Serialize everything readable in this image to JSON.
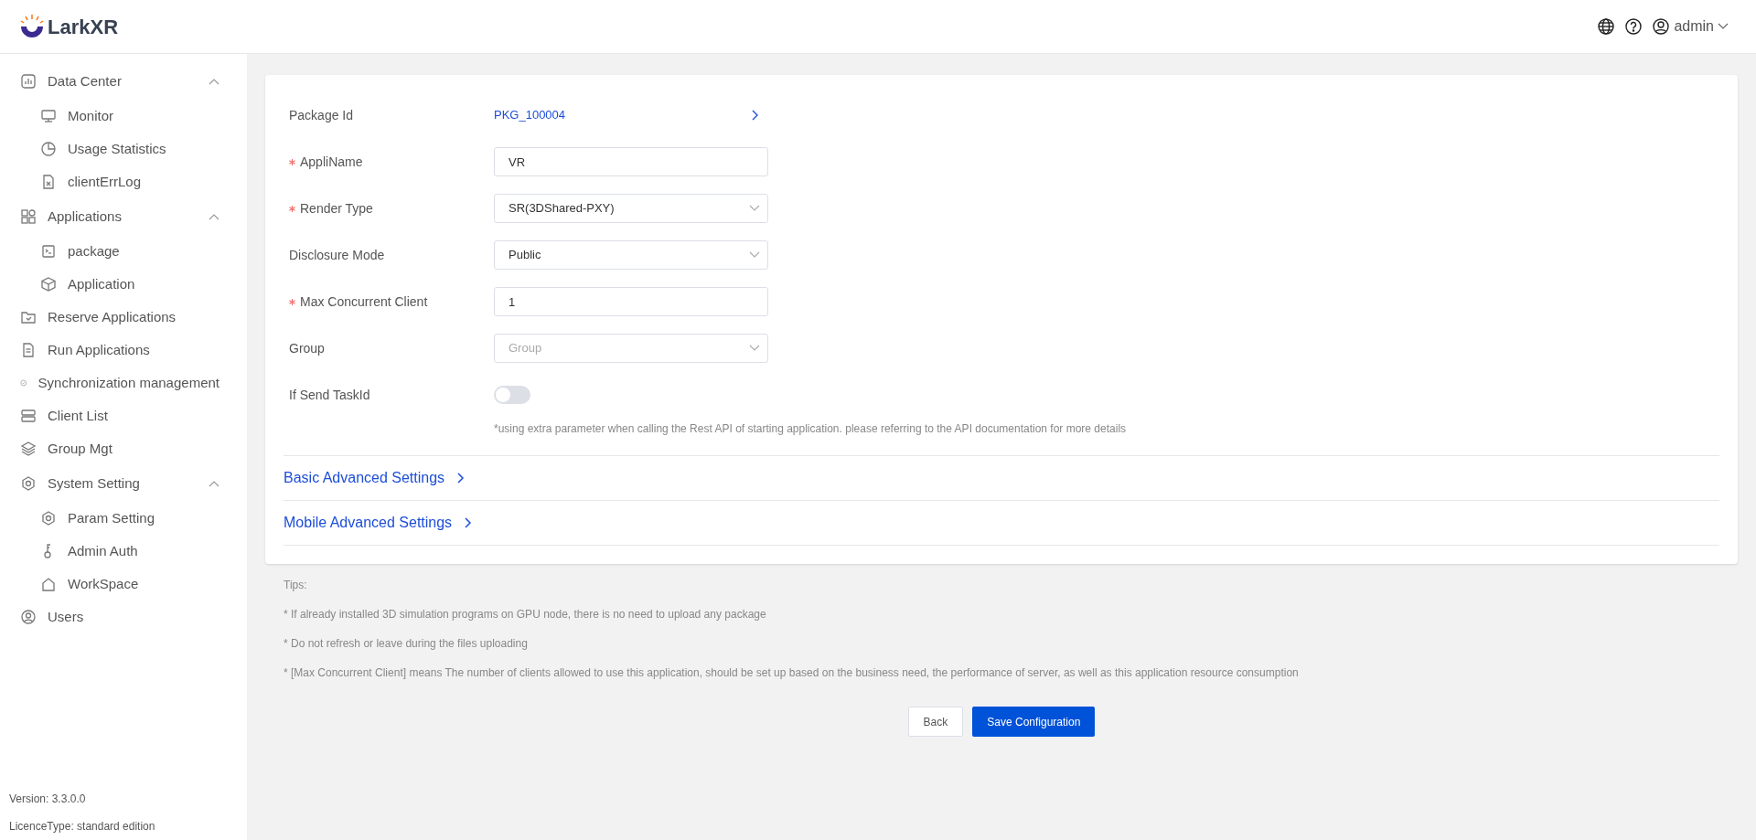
{
  "header": {
    "logo": "LarkXR",
    "user": "admin"
  },
  "sidebar": {
    "items": [
      {
        "label": "Data Center",
        "expanded": true,
        "children": [
          {
            "label": "Monitor"
          },
          {
            "label": "Usage Statistics"
          },
          {
            "label": "clientErrLog"
          }
        ]
      },
      {
        "label": "Applications",
        "expanded": true,
        "children": [
          {
            "label": "package"
          },
          {
            "label": "Application"
          }
        ]
      },
      {
        "label": "Reserve Applications"
      },
      {
        "label": "Run Applications"
      },
      {
        "label": "Synchronization management"
      },
      {
        "label": "Client List"
      },
      {
        "label": "Group Mgt"
      },
      {
        "label": "System Setting",
        "expanded": true,
        "children": [
          {
            "label": "Param Setting"
          },
          {
            "label": "Admin Auth"
          },
          {
            "label": "WorkSpace"
          }
        ]
      },
      {
        "label": "Users"
      }
    ],
    "footer": [
      "Version: 3.3.0.0",
      "LicenceType: standard edition"
    ]
  },
  "form": {
    "fields": [
      {
        "kind": "link",
        "label": "Package Id",
        "required": false,
        "value": "PKG_100004"
      },
      {
        "kind": "input",
        "label": "AppliName",
        "required": true,
        "value": "VR"
      },
      {
        "kind": "select",
        "label": "Render Type",
        "required": true,
        "value": "SR(3DShared-PXY)"
      },
      {
        "kind": "select",
        "label": "Disclosure Mode",
        "required": false,
        "value": "Public"
      },
      {
        "kind": "input",
        "label": "Max Concurrent Client",
        "required": true,
        "value": "1"
      },
      {
        "kind": "select",
        "label": "Group",
        "required": false,
        "placeholder": "Group"
      },
      {
        "kind": "switch",
        "label": "If Send TaskId",
        "required": false,
        "on": false,
        "note": "*using extra parameter when calling the Rest API of starting application. please referring to the API documentation for more details"
      }
    ],
    "sections": [
      {
        "label": "Basic Advanced Settings",
        "expanded": false
      },
      {
        "label": "Mobile Advanced Settings",
        "expanded": false
      }
    ]
  },
  "tips": [
    "Tips:",
    "* If already installed 3D simulation programs on GPU node, there is no need to upload any package",
    "* Do not refresh or leave during the files uploading",
    "* [Max Concurrent Client] means The number of clients allowed to use this application, should be set up based on the business need, the performance of server, as well as this application resource consumption"
  ],
  "buttons": [
    {
      "kind": "secondary",
      "label": "Back"
    },
    {
      "kind": "primary",
      "label": "Save Configuration"
    }
  ]
}
